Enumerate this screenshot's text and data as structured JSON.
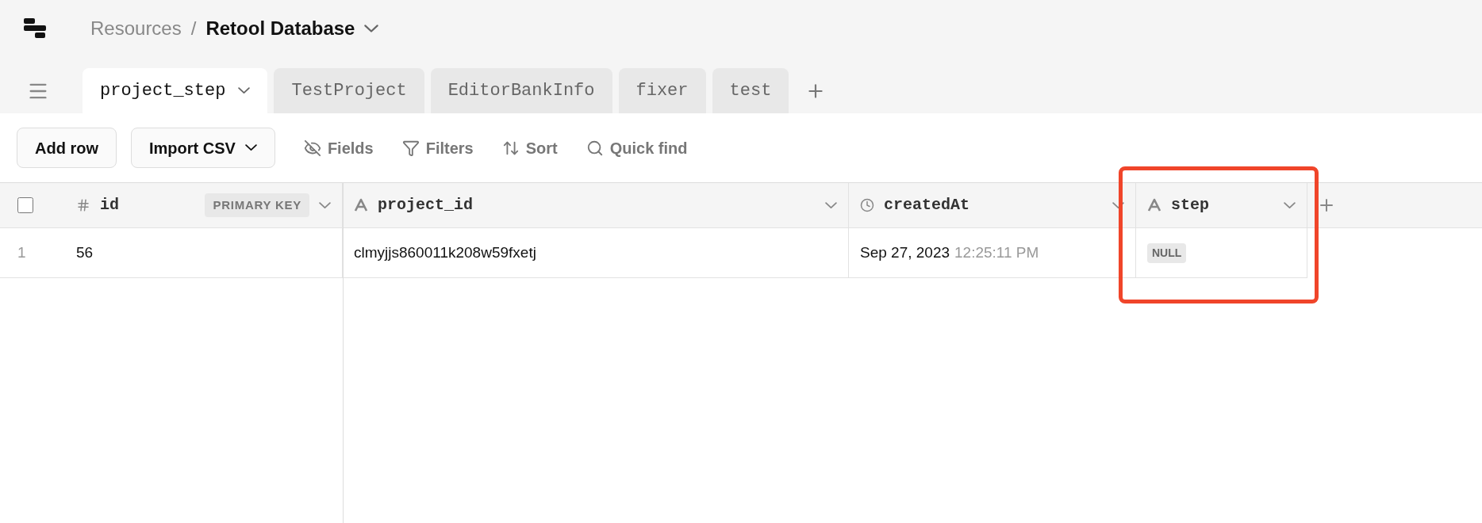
{
  "breadcrumb": {
    "parent": "Resources",
    "separator": "/",
    "current": "Retool Database"
  },
  "tabs": [
    {
      "label": "project_step",
      "selected": true
    },
    {
      "label": "TestProject",
      "selected": false
    },
    {
      "label": "EditorBankInfo",
      "selected": false
    },
    {
      "label": "fixer",
      "selected": false
    },
    {
      "label": "test",
      "selected": false
    }
  ],
  "toolbar": {
    "buttons": [
      {
        "label": "Add row",
        "kind": "plain"
      },
      {
        "label": "Import CSV",
        "kind": "dropdown"
      }
    ],
    "actions": [
      {
        "label": "Fields",
        "kind": "fields"
      },
      {
        "label": "Filters",
        "kind": "filters"
      },
      {
        "label": "Sort",
        "kind": "sort"
      },
      {
        "label": "Quick find",
        "kind": "search"
      }
    ]
  },
  "table": {
    "select_all": {
      "checked": false
    },
    "columns": [
      {
        "name": "id",
        "kind": "number",
        "badge": "PRIMARY KEY"
      },
      {
        "name": "project_id",
        "kind": "text"
      },
      {
        "name": "createdAt",
        "kind": "datetime"
      },
      {
        "name": "step",
        "kind": "text",
        "highlighted": true
      }
    ],
    "rows": [
      {
        "number": "1",
        "cells": [
          {
            "kind": "text",
            "value": "56"
          },
          {
            "kind": "text",
            "value": "clmyjjs860011k208w59fxetj"
          },
          {
            "kind": "datetime",
            "date": "Sep 27, 2023",
            "time": "12:25:11 PM"
          },
          {
            "kind": "null",
            "value": "NULL"
          }
        ]
      }
    ]
  }
}
